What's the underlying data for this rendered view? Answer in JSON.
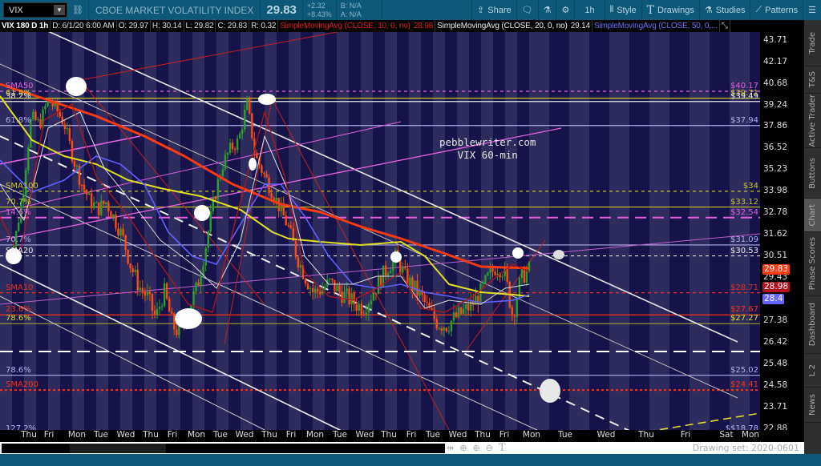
{
  "toolbar": {
    "symbol": "VIX",
    "description": "CBOE MARKET VOLATILITY INDEX",
    "last": "29.83",
    "change": "+2.32",
    "change_pct": "+8.43%",
    "bid": "B: N/A",
    "ask": "A: N/A",
    "share": "Share",
    "timeframe": "1h",
    "style": "Style",
    "drawings": "Drawings",
    "studies": "Studies",
    "patterns": "Patterns"
  },
  "infobar": {
    "title": "VIX 180 D 1h",
    "date": "D: 6/1/20 6:00 AM",
    "open": "O: 29.97",
    "high": "H: 30.14",
    "low": "L: 29.82",
    "close": "C: 29.83",
    "range": "R: 0.32",
    "sma10": "SimpleMovingAvg (CLOSE, 10, 0, no)",
    "sma10_val": "28.98",
    "sma20": "SimpleMovingAvg (CLOSE, 20, 0, no)",
    "sma20_val": "29.14",
    "sma50": "SimpleMovingAvg (CLOSE, 50, 0,..."
  },
  "watermark": {
    "line1": "pebblewriter.com",
    "line2": "VIX 60-min"
  },
  "price_ticks": [
    "43.71",
    "42.17",
    "40.68",
    "39.24",
    "37.86",
    "36.52",
    "35.23",
    "33.98",
    "32.78",
    "31.62",
    "30.51",
    "29.43",
    "27.38",
    "26.42",
    "25.48",
    "24.58",
    "23.71",
    "22.88"
  ],
  "badges": [
    {
      "value": "29.83",
      "price": 29.83,
      "color": "#ff3b14"
    },
    {
      "value": "28.98",
      "price": 28.98,
      "color": "#b3121a"
    },
    {
      "value": "28.4",
      "price": 28.4,
      "color": "#6565ff"
    }
  ],
  "levels": [
    {
      "price": 40.17,
      "right": "$40.17",
      "left": "SMA50",
      "color": "#e060e0",
      "style": "dash"
    },
    {
      "price": 39.71,
      "right": "$39.71",
      "left": "61.8%",
      "color": "#c8c81e",
      "style": "solid"
    },
    {
      "price": 39.49,
      "right": "$39.49",
      "left": "38.2%",
      "color": "#e8e8e8",
      "style": "solid"
    },
    {
      "price": 37.94,
      "right": "$37.94",
      "left": "61.8%",
      "color": "#b0b0f0",
      "style": "solid"
    },
    {
      "price": 34.0,
      "right": "$34",
      "left": "SMA100",
      "color": "#c8c81e",
      "style": "dash"
    },
    {
      "price": 33.12,
      "right": "$33.12",
      "left": "70.7%",
      "color": "#c8c81e",
      "style": "solid"
    },
    {
      "price": 32.54,
      "right": "$32.54",
      "left": "14.6%",
      "color": "#e060e0",
      "style": "longdash"
    },
    {
      "price": 31.09,
      "right": "$31.09",
      "left": "70.7%",
      "color": "#b0b0f0",
      "style": "solid"
    },
    {
      "price": 30.53,
      "right": "$30.53",
      "left": "SMA20",
      "color": "#e8e8e8",
      "style": "dash"
    },
    {
      "price": 28.71,
      "right": "$28.71",
      "left": "SMA10",
      "color": "#e03020",
      "style": "dash"
    },
    {
      "price": 27.67,
      "right": "$27.67",
      "left": "23.6%",
      "color": "#ff3010",
      "style": "solid"
    },
    {
      "price": 27.27,
      "right": "$27.27",
      "left": "78.6%",
      "color": "#a0a030",
      "style": "solid"
    },
    {
      "price": 25.02,
      "right": "$25.02",
      "left": "78.6%",
      "color": "#b0b0f0",
      "style": "solid"
    },
    {
      "price": 24.41,
      "right": "$24.41",
      "left": "SMA200",
      "color": "#ff3010",
      "style": "dot"
    },
    {
      "price": 22.7,
      "right": "$$18.78",
      "left": "127.2%",
      "color": "#b0b0f0",
      "style": "none"
    }
  ],
  "closes": [
    30.5,
    31.2,
    34,
    38.5,
    38,
    39.6,
    39,
    38,
    36,
    34.5,
    33.5,
    33,
    33.4,
    32.5,
    31.5,
    30,
    29,
    28.5,
    27.5,
    28.8,
    27.2,
    26.8,
    28,
    29,
    31,
    33.5,
    35.5,
    36.5,
    37,
    39.4,
    36,
    35,
    34,
    33,
    32,
    30.5,
    29.5,
    28.7,
    28.9,
    29.2,
    28.8,
    28.5,
    28.2,
    28,
    28.6,
    29.3,
    30,
    30.5,
    29.5,
    29,
    28.5,
    27.8,
    27.3,
    27.2,
    27.5,
    27.8,
    28.1,
    28.6,
    29.4,
    30,
    29.8,
    27.6,
    29.4,
    29.83
  ],
  "time_axis": [
    "Thu",
    "Fri",
    "Mon",
    "Tue",
    "Wed",
    "Thu",
    "Fri",
    "Mon",
    "Tue",
    "Wed",
    "Thu",
    "Fri",
    "Mon",
    "Tue",
    "Wed",
    "Thu",
    "Fri",
    "Tue",
    "Wed",
    "Thu",
    "Fri",
    "Mon",
    "Tue",
    "Wed",
    "Thu",
    "Fri",
    "Sat",
    "Mon"
  ],
  "sidebar": [
    "Trade",
    "T&S",
    "Active Trader",
    "Buttons",
    "Chart",
    "Phase Scores",
    "Dashboard",
    "L 2",
    "News"
  ],
  "footer": {
    "drawing_set": "Drawing set: 2020-0601"
  }
}
